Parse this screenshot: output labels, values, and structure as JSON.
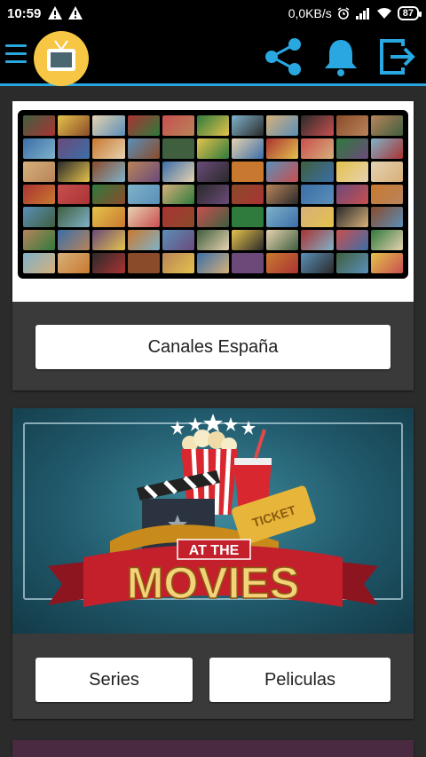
{
  "status_bar": {
    "time": "10:59",
    "network_speed": "0,0KB/s",
    "battery": "87"
  },
  "app_bar": {
    "accent_color": "#29a7e0",
    "logo_color": "#f7c644"
  },
  "cards": [
    {
      "image": "tv-channel-wall-image",
      "buttons": [
        "Canales España"
      ]
    },
    {
      "image": "at-the-movies-image",
      "image_text": [
        "AT THE",
        "MOVIES",
        "TICKET"
      ],
      "buttons": [
        "Series",
        "Peliculas"
      ]
    }
  ]
}
